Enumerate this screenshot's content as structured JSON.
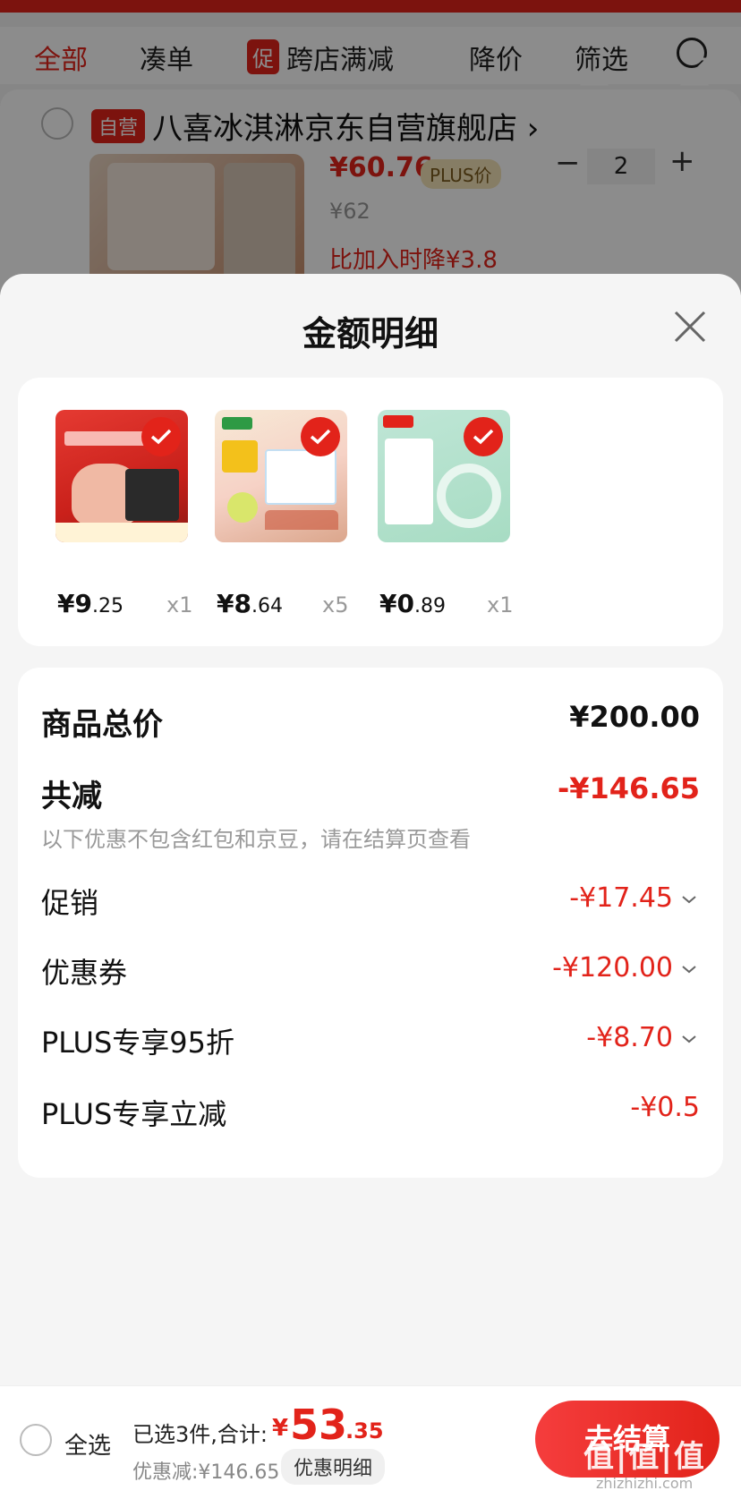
{
  "background": {
    "tabs": [
      "全部",
      "凑单",
      "跨店满减",
      "降价",
      "筛选"
    ],
    "promo_tag": "促",
    "store": {
      "self_tag": "自营",
      "name": "八喜冰淇淋京东自营旗舰店 ›"
    },
    "product": {
      "price": "¥60.76",
      "plus_tag": "PLUS价",
      "original_price": "¥62",
      "price_drop": "比加入时降¥3.8",
      "quantity": "2",
      "minus": "−",
      "plus": "+"
    }
  },
  "sheet": {
    "title": "金额明细",
    "goods": [
      {
        "price_int": "¥9",
        "price_dec": ".25",
        "qty": "x1"
      },
      {
        "price_int": "¥8",
        "price_dec": ".64",
        "qty": "x5"
      },
      {
        "price_int": "¥0",
        "price_dec": ".89",
        "qty": "x1"
      }
    ],
    "details": {
      "total_label": "商品总价",
      "total_value": "¥200.00",
      "discount_label": "共减",
      "discount_value": "-¥146.65",
      "note": "以下优惠不包含红包和京豆，请在结算页查看",
      "promo_label": "促销",
      "promo_value": "-¥17.45",
      "coupon_label": "优惠券",
      "coupon_value": "-¥120.00",
      "plus95_label": "PLUS专享95折",
      "plus95_value": "-¥8.70",
      "plusinstant_label": "PLUS专享立减",
      "plusinstant_value": "-¥0.5"
    }
  },
  "bottom": {
    "select_all": "全选",
    "selected_summary": "已选3件,合计:",
    "yen": "¥",
    "total_int": "53",
    "total_dec": ".35",
    "saved": "优惠减:¥146.65",
    "detail_button": "优惠明细",
    "checkout": "去结算",
    "watermark": "值|值|值",
    "watermark_url": "zhizhizhi.com"
  },
  "colors": {
    "accent": "#e2231a",
    "plus_gold": "#f5e4b8"
  },
  "icons": [
    "search-icon",
    "download-icon",
    "share-icon",
    "close-icon",
    "check-icon",
    "chevron-down-icon",
    "radio-icon"
  ]
}
